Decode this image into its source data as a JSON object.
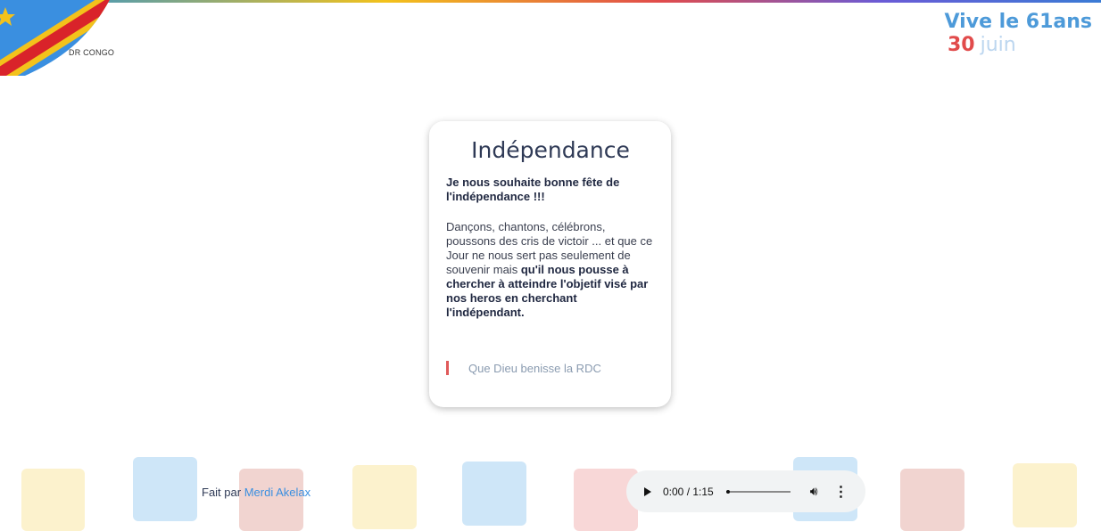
{
  "header": {
    "country_label": "DR CONGO",
    "vive_text": "Vive le 61ans",
    "date_day": "30",
    "date_month": "juin"
  },
  "card": {
    "title": "Indépendance",
    "greeting": "Je nous souhaite bonne fête de l'indépendance !!!",
    "body_regular": "Dançons, chantons, célébrons, poussons des cris de victoir ... et que ce Jour ne nous sert pas seulement de souvenir mais",
    "body_bold": "qu'il nous pousse à chercher à atteindre l'objetif visé par nos heros en cherchant l'indépendant.",
    "quote": "Que Dieu benisse la RDC"
  },
  "footer": {
    "credit_prefix": "Fait par",
    "credit_author": "Merdi Akelax"
  },
  "audio": {
    "time": "0:00 / 1:15",
    "play_icon": "play-icon",
    "volume_icon": "volume-icon",
    "more_icon": "more-vertical-icon"
  },
  "colors": {
    "accent_blue": "#4d9ad9",
    "accent_red": "#e14b4b",
    "title_text": "#2f3a56"
  }
}
